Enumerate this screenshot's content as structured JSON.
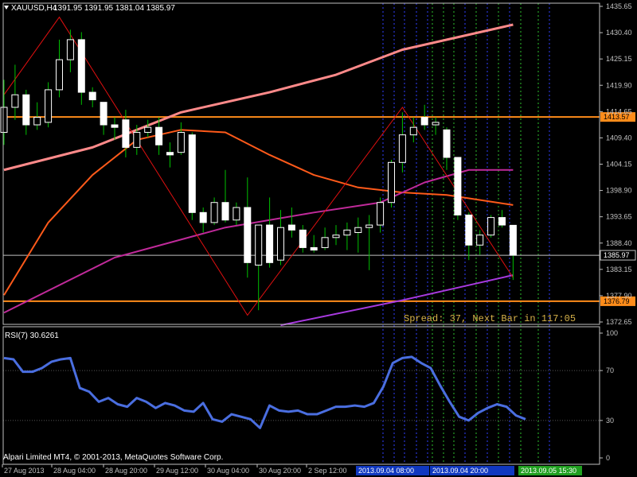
{
  "header": {
    "symbol_label": "XAUUSD,H4",
    "ohlc": "1391.95 1391.95 1381.04 1385.97",
    "dropdown_icon": "triangle-down-icon"
  },
  "status": {
    "spread_text": "Spread: 37, Next Bar in 117:05",
    "copyright": "Alpari Limited MT4, © 2001-2013, MetaQuotes Software Corp."
  },
  "price_axis": {
    "ticks": [
      "1435.65",
      "1430.40",
      "1425.15",
      "1419.90",
      "1414.65",
      "1409.40",
      "1404.15",
      "1398.90",
      "1393.65",
      "1388.40",
      "1383.15",
      "1377.90",
      "1372.65"
    ],
    "markers": [
      {
        "label": "1413.57",
        "value": 1413.57,
        "color": "#ff8c1a"
      },
      {
        "label": "1385.97",
        "value": 1385.97,
        "color": "#c0c0c0"
      },
      {
        "label": "1376.79",
        "value": 1376.79,
        "color": "#ff8c1a"
      }
    ]
  },
  "rsi": {
    "label": "RSI(7) 30.6261",
    "ticks": [
      "100",
      "70",
      "30",
      "0"
    ],
    "color": "#4a6ee0",
    "values": [
      80,
      79,
      69,
      69,
      72,
      77,
      79,
      80,
      56,
      53,
      45,
      48,
      43,
      41,
      48,
      45,
      40,
      44,
      42,
      38,
      37,
      44,
      31,
      29,
      35,
      33,
      31,
      24,
      42,
      38,
      37,
      38,
      35,
      35,
      38,
      41,
      41,
      42,
      41,
      44,
      57,
      76,
      80,
      81,
      76,
      72,
      58,
      45,
      33,
      30,
      36,
      40,
      43,
      41,
      34,
      31
    ]
  },
  "time_axis": {
    "labels": [
      "27 Aug 2013",
      "28 Aug 04:00",
      "28 Aug 20:00",
      "29 Aug 12:00",
      "30 Aug 04:00",
      "30 Aug 20:00",
      "2 Sep 12:00"
    ],
    "highlight_labels": [
      "2013.09.04 08:00",
      "2013.09.04 20:00",
      "2013.09.05 15:30"
    ]
  },
  "colors": {
    "background": "#000000",
    "axis": "#c0c0c0",
    "bull": "#ffffff",
    "bear": "#ffffff",
    "wick": "#00c000",
    "spread_text": "#d7b24a",
    "ma_fast": "#ff5a1a",
    "ma_slow": "#ff8a8a",
    "ma_mid": "#c02a9a",
    "ma_long": "#a83ae0",
    "zigzag": "#e01010",
    "level": "#ff8c1a"
  },
  "chart_data": {
    "type": "candlestick",
    "symbol": "XAUUSD",
    "timeframe": "H4",
    "ylim": [
      1372.65,
      1435.65
    ],
    "candles": [
      {
        "o": 1410.5,
        "h": 1421.0,
        "l": 1408.0,
        "c": 1415.5
      },
      {
        "o": 1415.5,
        "h": 1424.0,
        "l": 1413.0,
        "c": 1418.0
      },
      {
        "o": 1418.0,
        "h": 1419.0,
        "l": 1410.0,
        "c": 1412.0
      },
      {
        "o": 1412.0,
        "h": 1416.5,
        "l": 1411.0,
        "c": 1413.5
      },
      {
        "o": 1412.5,
        "h": 1420.5,
        "l": 1411.5,
        "c": 1419.0
      },
      {
        "o": 1419.0,
        "h": 1429.0,
        "l": 1417.5,
        "c": 1425.0
      },
      {
        "o": 1425.0,
        "h": 1431.0,
        "l": 1422.5,
        "c": 1429.0
      },
      {
        "o": 1429.0,
        "h": 1430.5,
        "l": 1416.0,
        "c": 1418.5
      },
      {
        "o": 1418.5,
        "h": 1419.5,
        "l": 1415.5,
        "c": 1417.0
      },
      {
        "o": 1416.5,
        "h": 1416.5,
        "l": 1410.0,
        "c": 1412.0
      },
      {
        "o": 1412.0,
        "h": 1413.5,
        "l": 1409.0,
        "c": 1411.5
      },
      {
        "o": 1413.0,
        "h": 1415.0,
        "l": 1405.5,
        "c": 1407.5
      },
      {
        "o": 1407.5,
        "h": 1412.0,
        "l": 1406.0,
        "c": 1410.5
      },
      {
        "o": 1410.5,
        "h": 1413.0,
        "l": 1409.5,
        "c": 1411.5
      },
      {
        "o": 1411.5,
        "h": 1413.5,
        "l": 1406.0,
        "c": 1408.0
      },
      {
        "o": 1406.5,
        "h": 1408.5,
        "l": 1403.5,
        "c": 1406.0
      },
      {
        "o": 1406.5,
        "h": 1412.5,
        "l": 1406.0,
        "c": 1410.5
      },
      {
        "o": 1410.0,
        "h": 1410.5,
        "l": 1393.0,
        "c": 1394.5
      },
      {
        "o": 1394.5,
        "h": 1395.5,
        "l": 1390.5,
        "c": 1392.5
      },
      {
        "o": 1392.5,
        "h": 1397.5,
        "l": 1392.0,
        "c": 1396.5
      },
      {
        "o": 1396.5,
        "h": 1403.0,
        "l": 1392.5,
        "c": 1393.0
      },
      {
        "o": 1393.0,
        "h": 1396.5,
        "l": 1392.0,
        "c": 1395.5
      },
      {
        "o": 1395.5,
        "h": 1401.5,
        "l": 1381.5,
        "c": 1384.5
      },
      {
        "o": 1384.0,
        "h": 1389.0,
        "l": 1375.0,
        "c": 1392.0
      },
      {
        "o": 1392.0,
        "h": 1397.5,
        "l": 1383.5,
        "c": 1384.5
      },
      {
        "o": 1385.0,
        "h": 1395.0,
        "l": 1384.0,
        "c": 1391.5
      },
      {
        "o": 1392.0,
        "h": 1395.5,
        "l": 1389.5,
        "c": 1391.0
      },
      {
        "o": 1391.0,
        "h": 1392.0,
        "l": 1386.5,
        "c": 1387.5
      },
      {
        "o": 1387.5,
        "h": 1390.0,
        "l": 1386.5,
        "c": 1387.0
      },
      {
        "o": 1387.5,
        "h": 1391.5,
        "l": 1387.0,
        "c": 1389.5
      },
      {
        "o": 1389.5,
        "h": 1392.0,
        "l": 1388.0,
        "c": 1390.0
      },
      {
        "o": 1390.0,
        "h": 1392.5,
        "l": 1387.0,
        "c": 1391.0
      },
      {
        "o": 1390.5,
        "h": 1393.5,
        "l": 1386.5,
        "c": 1391.5
      },
      {
        "o": 1391.5,
        "h": 1394.0,
        "l": 1383.0,
        "c": 1392.0
      },
      {
        "o": 1392.0,
        "h": 1397.5,
        "l": 1390.5,
        "c": 1396.5
      },
      {
        "o": 1396.5,
        "h": 1405.0,
        "l": 1395.5,
        "c": 1404.5
      },
      {
        "o": 1404.5,
        "h": 1414.5,
        "l": 1402.5,
        "c": 1410.0
      },
      {
        "o": 1410.0,
        "h": 1413.5,
        "l": 1408.5,
        "c": 1411.5
      },
      {
        "o": 1413.5,
        "h": 1416.0,
        "l": 1411.0,
        "c": 1412.0
      },
      {
        "o": 1412.0,
        "h": 1413.5,
        "l": 1410.0,
        "c": 1412.5
      },
      {
        "o": 1411.0,
        "h": 1411.5,
        "l": 1403.0,
        "c": 1405.5
      },
      {
        "o": 1405.5,
        "h": 1405.5,
        "l": 1393.0,
        "c": 1394.0
      },
      {
        "o": 1394.0,
        "h": 1394.5,
        "l": 1385.0,
        "c": 1388.0
      },
      {
        "o": 1388.0,
        "h": 1391.0,
        "l": 1386.0,
        "c": 1390.0
      },
      {
        "o": 1390.0,
        "h": 1394.0,
        "l": 1389.5,
        "c": 1393.5
      },
      {
        "o": 1393.5,
        "h": 1395.0,
        "l": 1391.5,
        "c": 1392.0
      },
      {
        "o": 1391.95,
        "h": 1391.95,
        "l": 1381.04,
        "c": 1385.97
      }
    ],
    "zigzag": [
      [
        0,
        1418.0
      ],
      [
        5,
        1433.5
      ],
      [
        22,
        1374.0
      ],
      [
        36,
        1415.5
      ],
      [
        46,
        1381.5
      ]
    ],
    "moving_averages": [
      {
        "name": "ma_slow",
        "values": [
          {
            "i": 0,
            "v": 1403.0
          },
          {
            "i": 8,
            "v": 1407.5
          },
          {
            "i": 16,
            "v": 1414.5
          },
          {
            "i": 24,
            "v": 1418.5
          },
          {
            "i": 30,
            "v": 1422.0
          },
          {
            "i": 36,
            "v": 1427.0
          },
          {
            "i": 46,
            "v": 1432.0
          }
        ]
      },
      {
        "name": "ma_fast",
        "values": [
          {
            "i": 0,
            "v": 1378.0
          },
          {
            "i": 4,
            "v": 1392.5
          },
          {
            "i": 8,
            "v": 1402.0
          },
          {
            "i": 12,
            "v": 1409.0
          },
          {
            "i": 16,
            "v": 1411.0
          },
          {
            "i": 20,
            "v": 1410.5
          },
          {
            "i": 24,
            "v": 1406.0
          },
          {
            "i": 28,
            "v": 1402.0
          },
          {
            "i": 32,
            "v": 1399.5
          },
          {
            "i": 36,
            "v": 1398.5
          },
          {
            "i": 40,
            "v": 1398.0
          },
          {
            "i": 46,
            "v": 1396.0
          }
        ]
      },
      {
        "name": "ma_mid",
        "values": [
          {
            "i": 0,
            "v": 1374.5
          },
          {
            "i": 10,
            "v": 1385.5
          },
          {
            "i": 20,
            "v": 1391.5
          },
          {
            "i": 28,
            "v": 1394.5
          },
          {
            "i": 34,
            "v": 1396.5
          },
          {
            "i": 38,
            "v": 1400.5
          },
          {
            "i": 42,
            "v": 1403.0
          },
          {
            "i": 46,
            "v": 1403.0
          }
        ]
      },
      {
        "name": "ma_long",
        "values": [
          {
            "i": 25,
            "v": 1372.0
          },
          {
            "i": 36,
            "v": 1377.0
          },
          {
            "i": 42,
            "v": 1380.0
          },
          {
            "i": 46,
            "v": 1382.0
          }
        ]
      }
    ]
  }
}
